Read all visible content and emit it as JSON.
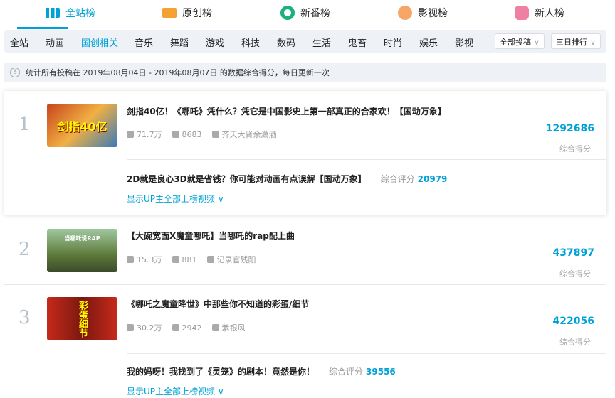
{
  "tabs": [
    {
      "label": "全站榜",
      "icon": "bar-chart-icon",
      "color": "#00a1d6"
    },
    {
      "label": "原创榜",
      "icon": "crown-icon",
      "color": "#f3a034"
    },
    {
      "label": "新番榜",
      "icon": "ring-icon",
      "color": "#1bb17b"
    },
    {
      "label": "影视榜",
      "icon": "film-reel-icon",
      "color": "#f6a767"
    },
    {
      "label": "新人榜",
      "icon": "new-user-icon",
      "color": "#f07fa4"
    }
  ],
  "nav": {
    "items": [
      "全站",
      "动画",
      "国创相关",
      "音乐",
      "舞蹈",
      "游戏",
      "科技",
      "数码",
      "生活",
      "鬼畜",
      "时尚",
      "娱乐",
      "影视"
    ],
    "active": "国创相关",
    "select1": "全部投稿",
    "select2": "三日排行"
  },
  "info": "统计所有投稿在 2019年08月04日 - 2019年08月07日 的数据综合得分，每日更新一次",
  "score_label": "综合得分",
  "sub_score_label": "综合评分",
  "show_more": "显示UP主全部上榜视频",
  "items": [
    {
      "rank": "1",
      "title": "剑指40亿！《哪吒》凭什么？凭它是中国影史上第一部真正的合家欢！【国动万象】",
      "thumb_text": "剑指40亿",
      "views": "71.7万",
      "danmaku": "8683",
      "author": "齐天大肾余潇洒",
      "score": "1292686",
      "sub_title": "2D就是良心3D就是省钱？你可能对动画有点误解【国动万象】",
      "sub_score": "20979"
    },
    {
      "rank": "2",
      "title": "【大碗宽面X魔童哪吒】当哪吒的rap配上曲",
      "thumb_text": "当哪吒说RAP",
      "views": "15.3万",
      "danmaku": "881",
      "author": "记录官残阳",
      "score": "437897"
    },
    {
      "rank": "3",
      "title": "《哪吒之魔童降世》中那些你不知道的彩蛋/细节",
      "thumb_text": "彩蛋细节",
      "views": "30.2万",
      "danmaku": "2942",
      "author": "紫银风",
      "score": "422056",
      "sub_title": "我的妈呀！我找到了《灵笼》的剧本！竟然是你！",
      "sub_score": "39556"
    }
  ]
}
